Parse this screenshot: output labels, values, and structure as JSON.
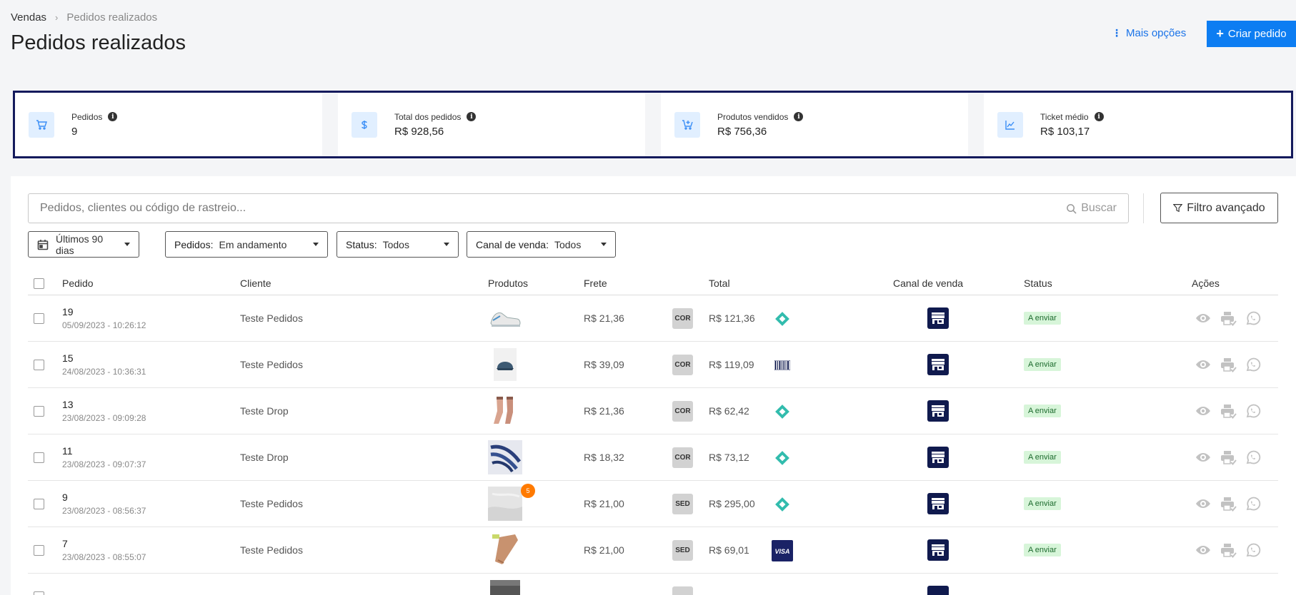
{
  "breadcrumb": {
    "root": "Vendas",
    "separator": "›",
    "current": "Pedidos realizados"
  },
  "page_title": "Pedidos realizados",
  "header": {
    "more_options": "Mais opções",
    "create_order": "Criar pedido"
  },
  "stats": [
    {
      "label": "Pedidos",
      "value": "9",
      "icon": "cart-icon"
    },
    {
      "label": "Total dos pedidos",
      "value": "R$ 928,56",
      "icon": "dollar-icon"
    },
    {
      "label": "Produtos vendidos",
      "value": "R$ 756,36",
      "icon": "cart-add-icon"
    },
    {
      "label": "Ticket médio",
      "value": "R$ 103,17",
      "icon": "chart-line-icon"
    }
  ],
  "search": {
    "placeholder": "Pedidos, clientes ou código de rastreio...",
    "button": "Buscar"
  },
  "advanced_filter": "Filtro avançado",
  "filters": {
    "period": {
      "value": "Últimos 90 dias"
    },
    "orders": {
      "label": "Pedidos:",
      "value": "Em andamento"
    },
    "status": {
      "label": "Status:",
      "value": "Todos"
    },
    "channel": {
      "label": "Canal de venda:",
      "value": "Todos"
    }
  },
  "table": {
    "headers": {
      "order": "Pedido",
      "client": "Cliente",
      "products": "Produtos",
      "freight": "Frete",
      "total": "Total",
      "channel": "Canal de venda",
      "status": "Status",
      "actions": "Ações"
    },
    "rows": [
      {
        "order": "19",
        "date": "05/09/2023 - 10:26:12",
        "client": "Teste Pedidos",
        "product": "sneaker",
        "freight": "R$ 21,36",
        "carrier": "COR",
        "total": "R$ 121,36",
        "payment": "pix-icon",
        "status": "A enviar"
      },
      {
        "order": "15",
        "date": "24/08/2023 - 10:36:31",
        "client": "Teste Pedidos",
        "product": "cap",
        "freight": "R$ 39,09",
        "carrier": "COR",
        "total": "R$ 119,09",
        "payment": "boleto-icon",
        "status": "A enviar"
      },
      {
        "order": "13",
        "date": "23/08/2023 - 09:09:28",
        "client": "Teste Drop",
        "product": "socks",
        "freight": "R$ 21,36",
        "carrier": "COR",
        "total": "R$ 62,42",
        "payment": "pix-icon",
        "status": "A enviar"
      },
      {
        "order": "11",
        "date": "23/08/2023 - 09:07:37",
        "client": "Teste Drop",
        "product": "scarf",
        "freight": "R$ 18,32",
        "carrier": "COR",
        "total": "R$ 73,12",
        "payment": "pix-icon",
        "status": "A enviar"
      },
      {
        "order": "9",
        "date": "23/08/2023 - 08:56:37",
        "client": "Teste Pedidos",
        "product": "fabric",
        "product_count": "5",
        "freight": "R$ 21,00",
        "carrier": "SED",
        "total": "R$ 295,00",
        "payment": "pix-icon",
        "status": "A enviar"
      },
      {
        "order": "7",
        "date": "23/08/2023 - 08:55:07",
        "client": "Teste Pedidos",
        "product": "stockings",
        "freight": "R$ 21,00",
        "carrier": "SED",
        "total": "R$ 69,01",
        "payment": "visa-icon",
        "visa_text": "VISA",
        "status": "A enviar"
      }
    ]
  },
  "colors": {
    "primary": "#0d7df2",
    "navy": "#101a4e",
    "pix": "#32bcad",
    "status_bg": "#d7f5d9"
  }
}
